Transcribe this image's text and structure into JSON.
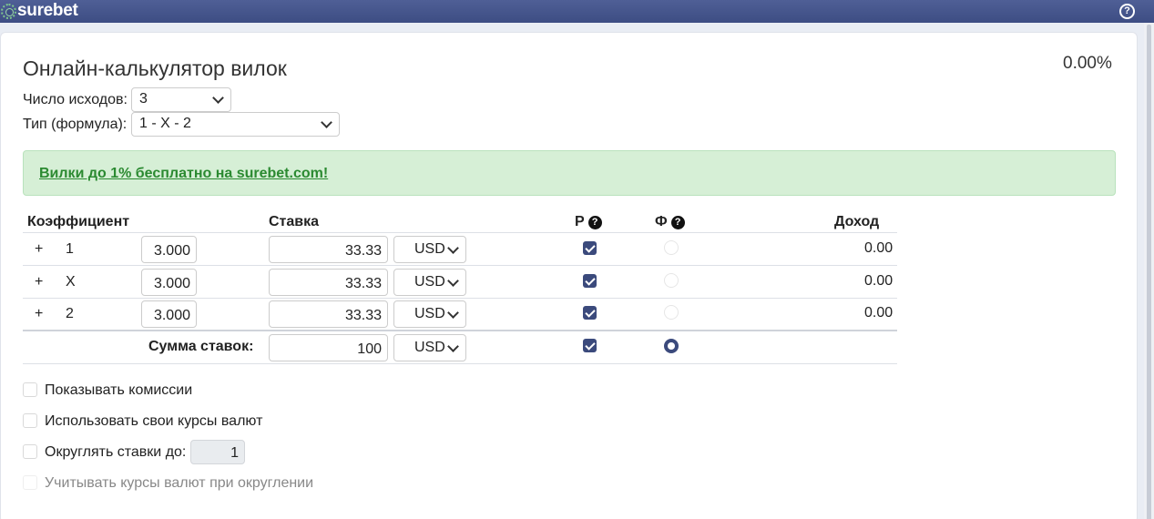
{
  "header": {
    "logo_text": "surebet",
    "help_glyph": "?"
  },
  "page": {
    "title": "Онлайн-калькулятор вилок",
    "profit_percent": "0.00%"
  },
  "settings": {
    "outcomes_label": "Число исходов:",
    "outcomes_value": "3",
    "formula_label": "Тип (формула):",
    "formula_value": "1 - X - 2"
  },
  "promo": {
    "text": "Вилки до 1% бесплатно на surebet.com!",
    "color": "#2b8a31"
  },
  "table": {
    "headers": {
      "odds": "Коэффициент",
      "stake": "Ставка",
      "r": "Р",
      "f": "Ф",
      "income": "Доход",
      "help_glyph": "?"
    },
    "rows": [
      {
        "plus": "+",
        "outcome": "1",
        "odds": "3.000",
        "stake": "33.33",
        "currency": "USD",
        "r_checked": true,
        "f_selected": false,
        "income": "0.00"
      },
      {
        "plus": "+",
        "outcome": "X",
        "odds": "3.000",
        "stake": "33.33",
        "currency": "USD",
        "r_checked": true,
        "f_selected": false,
        "income": "0.00"
      },
      {
        "plus": "+",
        "outcome": "2",
        "odds": "3.000",
        "stake": "33.33",
        "currency": "USD",
        "r_checked": true,
        "f_selected": false,
        "income": "0.00"
      }
    ],
    "total": {
      "label": "Сумма ставок:",
      "value": "100",
      "currency": "USD",
      "r_checked": true,
      "f_selected": true
    }
  },
  "options": {
    "show_commissions": "Показывать комиссии",
    "own_rates": "Использовать свои курсы валют",
    "round_stakes": "Округлять ставки до:",
    "round_value": "1",
    "rates_rounding": "Учитывать курсы валют при округлении"
  },
  "colors": {
    "header_bg": "#3d4d83",
    "accent": "#3b4a7c",
    "alert_bg": "#d6efd6"
  }
}
